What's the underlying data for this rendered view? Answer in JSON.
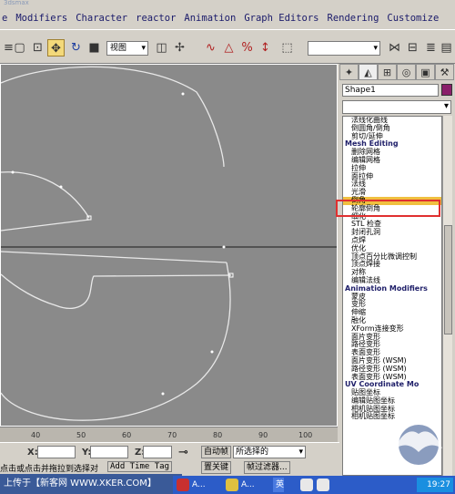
{
  "window": {
    "title": "3dsmax"
  },
  "menu": {
    "items": [
      "e",
      "Modifiers",
      "Character",
      "reactor",
      "Animation",
      "Graph Editors",
      "Rendering",
      "Customize"
    ]
  },
  "toolbar": {
    "view_select": "视图",
    "named_selection": ""
  },
  "command_panel": {
    "tabs": [
      "create-icon",
      "modify-icon",
      "hierarchy-icon",
      "motion-icon",
      "display-icon",
      "utilities-icon"
    ],
    "object_name": "Shape1",
    "object_color": "#8a1f6a",
    "modifier_list": [
      {
        "label": "法线化曲线",
        "kind": "item"
      },
      {
        "label": "倒圆角/倒角",
        "kind": "item"
      },
      {
        "label": "剪切/延伸",
        "kind": "item"
      },
      {
        "label": "Mesh Editing",
        "kind": "group"
      },
      {
        "label": "删除网格",
        "kind": "item"
      },
      {
        "label": "编辑网格",
        "kind": "item"
      },
      {
        "label": "拉伸",
        "kind": "item"
      },
      {
        "label": "面拉伸",
        "kind": "item"
      },
      {
        "label": "法线",
        "kind": "item"
      },
      {
        "label": "光滑",
        "kind": "item"
      },
      {
        "label": "倒角",
        "kind": "selected"
      },
      {
        "label": "轮廓倒角",
        "kind": "item"
      },
      {
        "label": "细化",
        "kind": "item"
      },
      {
        "label": "STL 检查",
        "kind": "item"
      },
      {
        "label": "封闭孔洞",
        "kind": "item"
      },
      {
        "label": "点焊",
        "kind": "item"
      },
      {
        "label": "优化",
        "kind": "item"
      },
      {
        "label": "顶点百分比微调控制",
        "kind": "item"
      },
      {
        "label": "顶点焊接",
        "kind": "item"
      },
      {
        "label": "对称",
        "kind": "item"
      },
      {
        "label": "编辑法线",
        "kind": "item"
      },
      {
        "label": "Animation Modifiers",
        "kind": "group"
      },
      {
        "label": "蒙皮",
        "kind": "item"
      },
      {
        "label": "变形",
        "kind": "item"
      },
      {
        "label": "伸缩",
        "kind": "item"
      },
      {
        "label": "融化",
        "kind": "item"
      },
      {
        "label": "XForm连接变形",
        "kind": "item"
      },
      {
        "label": "面片变形",
        "kind": "item"
      },
      {
        "label": "路径变形",
        "kind": "item"
      },
      {
        "label": "表面变形",
        "kind": "item"
      },
      {
        "label": "面片变形 (WSM)",
        "kind": "item"
      },
      {
        "label": "路径变形 (WSM)",
        "kind": "item"
      },
      {
        "label": "表面变形 (WSM)",
        "kind": "item"
      },
      {
        "label": "UV Coordinate Mo",
        "kind": "group"
      },
      {
        "label": "贴图坐标",
        "kind": "item"
      },
      {
        "label": "编辑贴图坐标",
        "kind": "item"
      },
      {
        "label": "相机贴图坐标",
        "kind": "item"
      },
      {
        "label": "相机贴图坐标",
        "kind": "item"
      }
    ]
  },
  "timeline": {
    "ticks": [
      "40",
      "50",
      "60",
      "70",
      "80",
      "90",
      "100"
    ]
  },
  "status": {
    "x_label": "X:",
    "y_label": "Y:",
    "z_label": "Z:",
    "auto_key": "自动帧",
    "set_key": "置关键",
    "selection_filter": "所选择的",
    "key_filters": "帧过滤器...",
    "prompt": "点击或点击并拖拉到选择对",
    "add_time_tag": "Add Time Tag"
  },
  "watermark": {
    "text": "上传于【新客网 WWW.XKER.COM】"
  },
  "taskbar": {
    "task1": "A...",
    "task2": "A...",
    "ime": "英",
    "clock": "19:27"
  },
  "colors": {
    "viewport_bg": "#8a8a8a",
    "selected_modifier": "#f0c040",
    "highlight_outline": "#e03030",
    "taskbar": "#2c5cc8"
  }
}
